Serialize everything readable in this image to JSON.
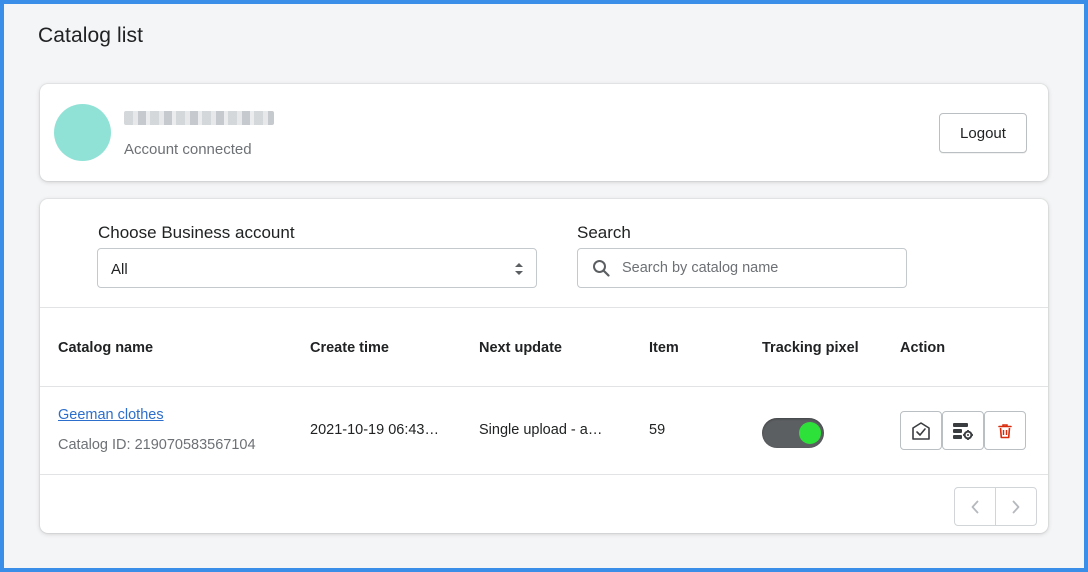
{
  "page": {
    "title": "Catalog list"
  },
  "account": {
    "status": "Account connected",
    "logout_label": "Logout"
  },
  "filters": {
    "business_account_label": "Choose Business account",
    "business_account_value": "All",
    "search_label": "Search",
    "search_placeholder": "Search by catalog name"
  },
  "table": {
    "headers": [
      "Catalog name",
      "Create time",
      "Next update",
      "Item",
      "Tracking pixel",
      "Action"
    ],
    "rows": [
      {
        "name": "Geeman clothes",
        "catalog_id": "Catalog ID: 219070583567104",
        "create_time": "2021-10-19 06:43…",
        "next_update": "Single upload - a…",
        "item": "59",
        "tracking_pixel": true
      }
    ]
  },
  "icons": {
    "search": "search-icon",
    "select_arrows": "chevron-up-down-icon",
    "sync": "catalog-sync-icon",
    "settings": "catalog-settings-icon",
    "delete": "trash-icon",
    "prev": "chevron-left-icon",
    "next": "chevron-right-icon"
  },
  "colors": {
    "frame_border": "#3b8ee8",
    "avatar": "#91e2d6",
    "link": "#2c6ecb",
    "toggle_on": "#2ee03a",
    "delete": "#d82c0d"
  }
}
